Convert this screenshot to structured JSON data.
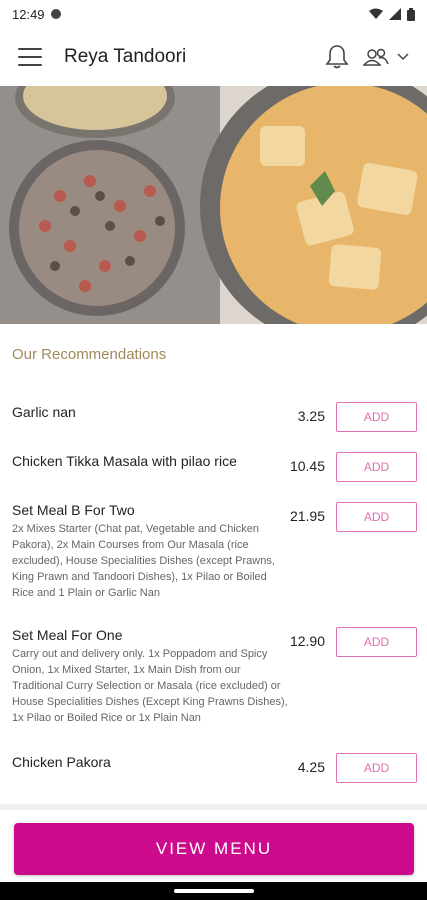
{
  "status_bar": {
    "time": "12:49"
  },
  "app_bar": {
    "title": "Reya Tandoori"
  },
  "section": {
    "title": "Our Recommendations"
  },
  "items": [
    {
      "name": "Garlic nan",
      "description": "",
      "price": "3.25",
      "button": "ADD"
    },
    {
      "name": "Chicken Tikka Masala with pilao rice",
      "description": "",
      "price": "10.45",
      "button": "ADD"
    },
    {
      "name": "Set Meal B For Two",
      "description": "2x Mixes Starter (Chat pat, Vegetable and Chicken Pakora), 2x Main Courses from Our Masala (rice excluded), House Specialities Dishes (except Prawns, King Prawn and Tandoori Dishes), 1x Pilao or Boiled Rice and 1 Plain or Garlic Nan",
      "price": "21.95",
      "button": "ADD"
    },
    {
      "name": "Set Meal For One",
      "description": "Carry out and delivery only. 1x Poppadom and Spicy Onion, 1x Mixed Starter, 1x Main Dish from our Traditional Curry Selection or Masala (rice excluded) or House Specialities Dishes (Except King Prawns Dishes), 1x Pilao or Boiled Rice or 1x Plain Nan",
      "price": "12.90",
      "button": "ADD"
    },
    {
      "name": "Chicken Pakora",
      "description": "",
      "price": "4.25",
      "button": "ADD"
    }
  ],
  "cta": {
    "label": "VIEW MENU"
  },
  "colors": {
    "accent": "#cc0a8c",
    "add_button": "#e06fb0",
    "section_title": "#a08a5a"
  }
}
